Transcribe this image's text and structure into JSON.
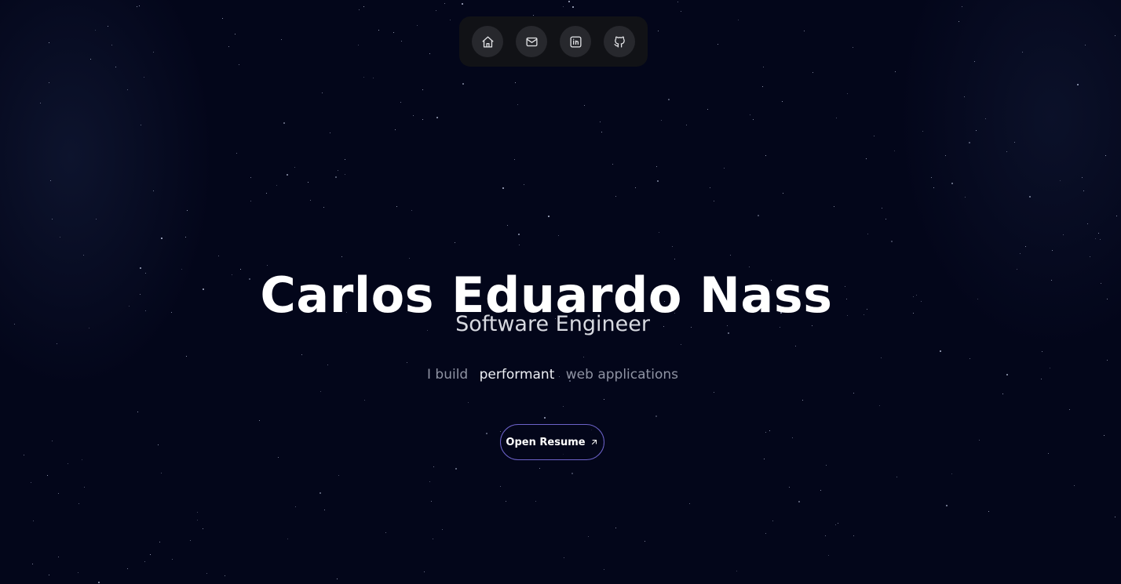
{
  "nav": {
    "items": [
      {
        "icon": "home-icon"
      },
      {
        "icon": "mail-icon"
      },
      {
        "icon": "linkedin-icon"
      },
      {
        "icon": "github-icon"
      }
    ]
  },
  "hero": {
    "name": "Carlos Eduardo Nass",
    "role": "Software Engineer",
    "tagline_before": "I build",
    "tagline_highlight": "performant",
    "tagline_after": "web applications"
  },
  "resume_button": {
    "label": "Open Resume",
    "icon": "arrow-up-right-icon"
  },
  "colors": {
    "background": "#03061a",
    "button_border": "#6c62c9",
    "highlight_text": "#eef0f5",
    "muted_text": "#8f93a3"
  }
}
